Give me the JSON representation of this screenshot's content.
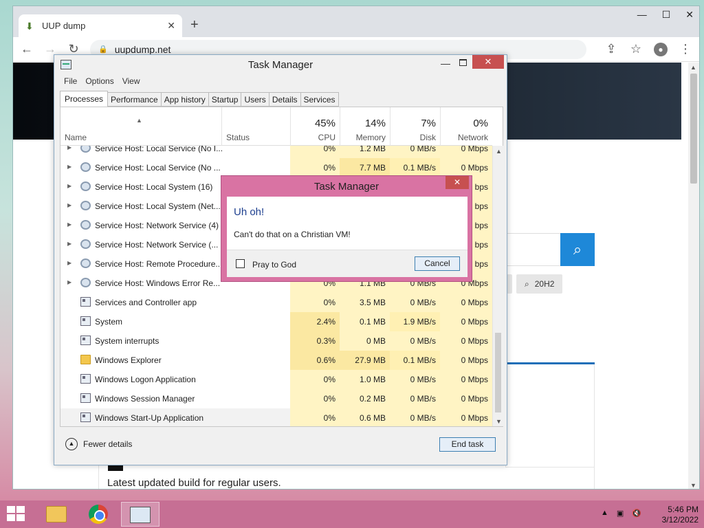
{
  "browser": {
    "tab_title": "UUP dump",
    "url": "uupdump.net",
    "new_tab": "+",
    "tab_close": "✕",
    "window_minimize": "—",
    "window_maximize": "☐",
    "window_close": "✕"
  },
  "page": {
    "chip_label": "20H2",
    "latest_text": "Latest updated build for regular users."
  },
  "task_manager": {
    "title": "Task Manager",
    "menu": [
      "File",
      "Options",
      "View"
    ],
    "tabs": [
      "Processes",
      "Performance",
      "App history",
      "Startup",
      "Users",
      "Details",
      "Services"
    ],
    "active_tab": "Processes",
    "columns": {
      "name": "Name",
      "status": "Status",
      "cpu_pct": "45%",
      "cpu": "CPU",
      "memory_pct": "14%",
      "memory": "Memory",
      "disk_pct": "7%",
      "disk": "Disk",
      "network_pct": "0%",
      "network": "Network"
    },
    "rows": [
      {
        "name": "Service Host: Local Service (No I...",
        "icon": "service",
        "expand": true,
        "cpu": "0%",
        "mem": "1.2 MB",
        "disk": "0 MB/s",
        "net": "0 Mbps"
      },
      {
        "name": "Service Host: Local Service (No ...",
        "icon": "service",
        "expand": true,
        "cpu": "0%",
        "mem": "7.7 MB",
        "disk": "0.1 MB/s",
        "net": "0 Mbps"
      },
      {
        "name": "Service Host: Local System (16)",
        "icon": "service",
        "expand": true,
        "cpu": "",
        "mem": "",
        "disk": "",
        "net": "bps"
      },
      {
        "name": "Service Host: Local System (Net...",
        "icon": "service",
        "expand": true,
        "cpu": "",
        "mem": "",
        "disk": "",
        "net": "bps"
      },
      {
        "name": "Service Host: Network Service (4)",
        "icon": "service",
        "expand": true,
        "cpu": "",
        "mem": "",
        "disk": "",
        "net": "bps"
      },
      {
        "name": "Service Host: Network Service (...",
        "icon": "service",
        "expand": true,
        "cpu": "",
        "mem": "",
        "disk": "",
        "net": "bps"
      },
      {
        "name": "Service Host: Remote Procedure...",
        "icon": "service",
        "expand": true,
        "cpu": "",
        "mem": "",
        "disk": "",
        "net": "bps"
      },
      {
        "name": "Service Host: Windows Error Re...",
        "icon": "service",
        "expand": true,
        "cpu": "0%",
        "mem": "1.1 MB",
        "disk": "0 MB/s",
        "net": "0 Mbps"
      },
      {
        "name": "Services and Controller app",
        "icon": "app",
        "expand": false,
        "cpu": "0%",
        "mem": "3.5 MB",
        "disk": "0 MB/s",
        "net": "0 Mbps"
      },
      {
        "name": "System",
        "icon": "app",
        "expand": false,
        "cpu": "2.4%",
        "mem": "0.1 MB",
        "disk": "1.9 MB/s",
        "net": "0 Mbps"
      },
      {
        "name": "System interrupts",
        "icon": "app",
        "expand": false,
        "cpu": "0.3%",
        "mem": "0 MB",
        "disk": "0 MB/s",
        "net": "0 Mbps"
      },
      {
        "name": "Windows Explorer",
        "icon": "folder",
        "expand": false,
        "cpu": "0.6%",
        "mem": "27.9 MB",
        "disk": "0.1 MB/s",
        "net": "0 Mbps"
      },
      {
        "name": "Windows Logon Application",
        "icon": "app",
        "expand": false,
        "cpu": "0%",
        "mem": "1.0 MB",
        "disk": "0 MB/s",
        "net": "0 Mbps"
      },
      {
        "name": "Windows Session Manager",
        "icon": "app",
        "expand": false,
        "cpu": "0%",
        "mem": "0.2 MB",
        "disk": "0 MB/s",
        "net": "0 Mbps"
      },
      {
        "name": "Windows Start-Up Application",
        "icon": "app",
        "expand": false,
        "cpu": "0%",
        "mem": "0.6 MB",
        "disk": "0 MB/s",
        "net": "0 Mbps",
        "selected": true
      }
    ],
    "fewer_details": "Fewer details",
    "end_task": "End task"
  },
  "dialog": {
    "title": "Task Manager",
    "heading": "Uh oh!",
    "message": "Can't do that on a Christian VM!",
    "checkbox_label": "Pray to God",
    "cancel": "Cancel",
    "close": "✕"
  },
  "taskbar": {
    "time": "5:46 PM",
    "date": "3/12/2022"
  },
  "colors": {
    "taskbar": "#c66f94",
    "dialog_frame": "#d973a3",
    "close_button": "#c75050",
    "search_button": "#1e88d8",
    "heading_blue": "#1d3f8f"
  }
}
